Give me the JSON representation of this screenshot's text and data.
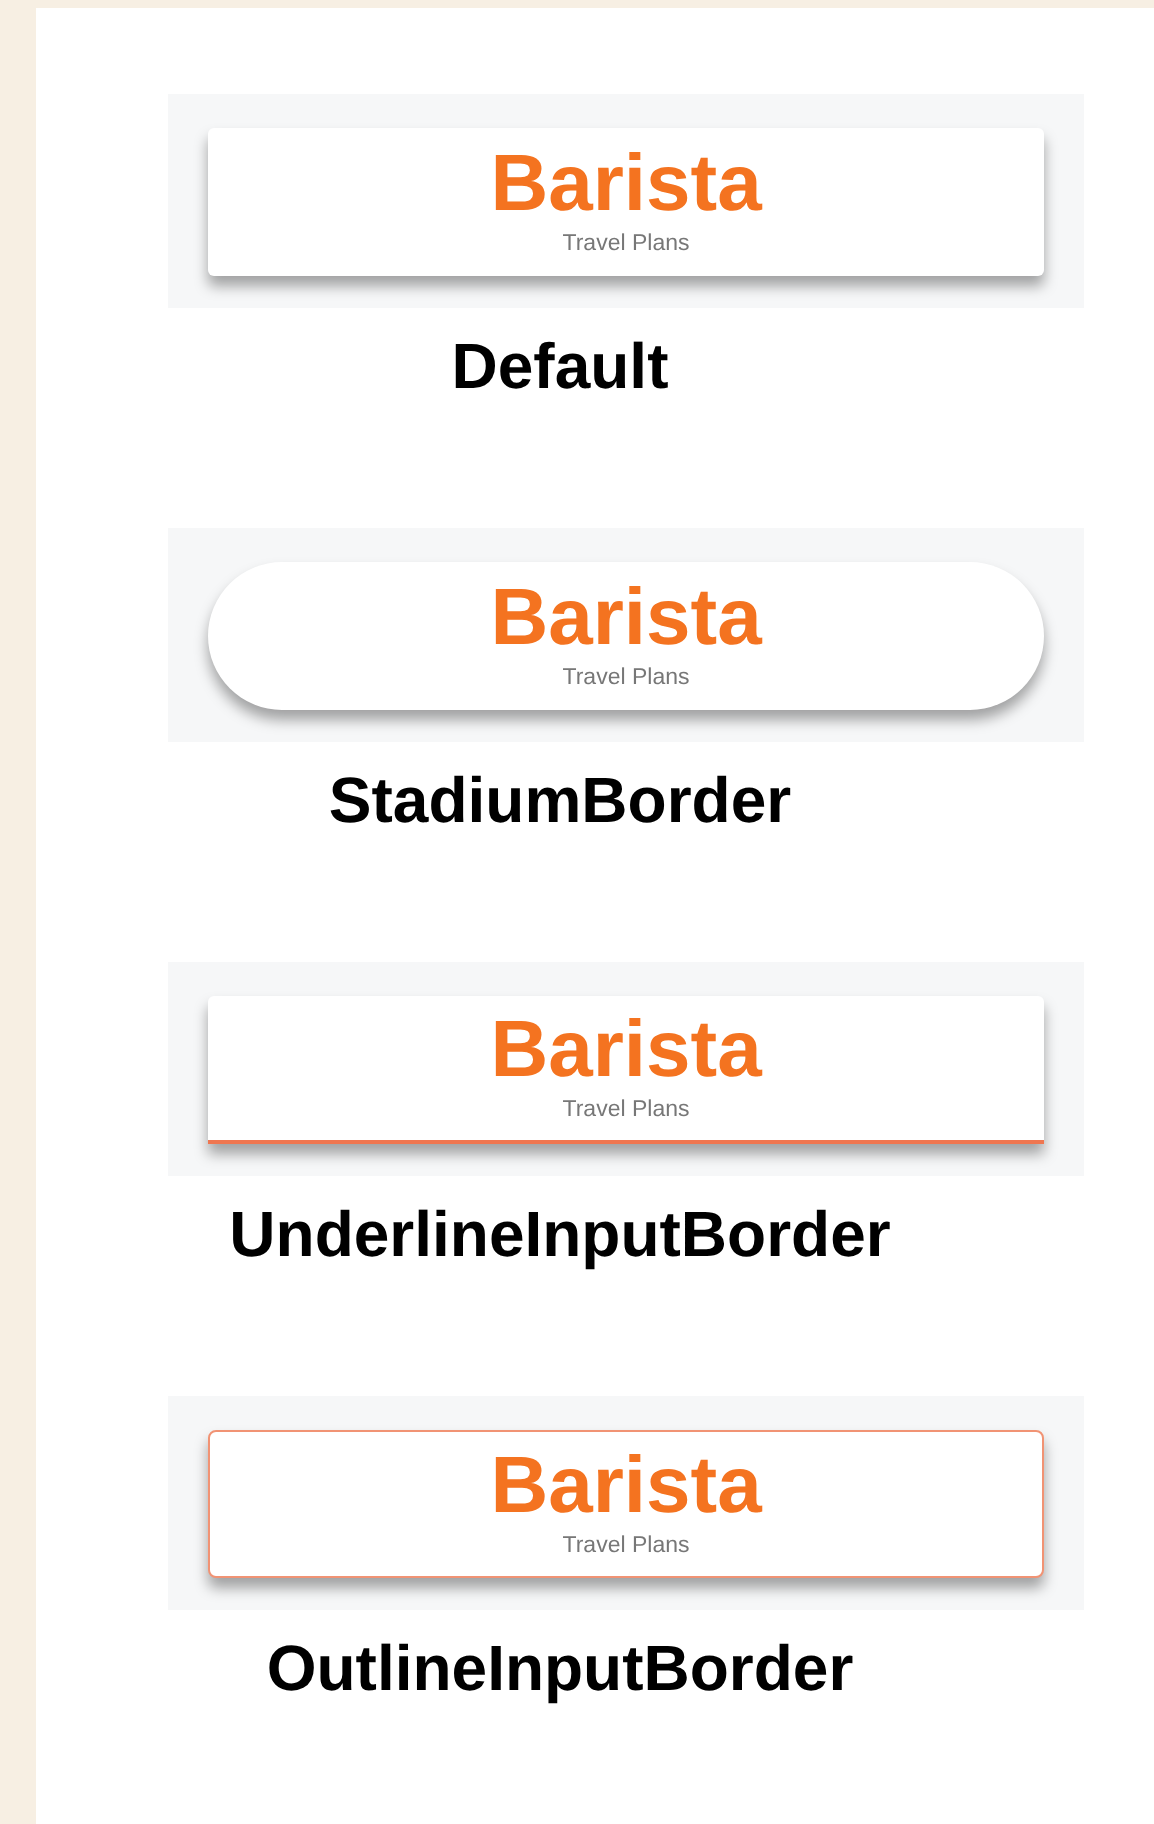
{
  "samples": [
    {
      "kind": "default",
      "title": "Barista",
      "subtitle": "Travel Plans",
      "label": "Default"
    },
    {
      "kind": "stadium",
      "title": "Barista",
      "subtitle": "Travel Plans",
      "label": "StadiumBorder"
    },
    {
      "kind": "underline",
      "title": "Barista",
      "subtitle": "Travel Plans",
      "label": "UnderlineInputBorder"
    },
    {
      "kind": "outline",
      "title": "Barista",
      "subtitle": "Travel Plans",
      "label": "OutlineInputBorder"
    }
  ]
}
